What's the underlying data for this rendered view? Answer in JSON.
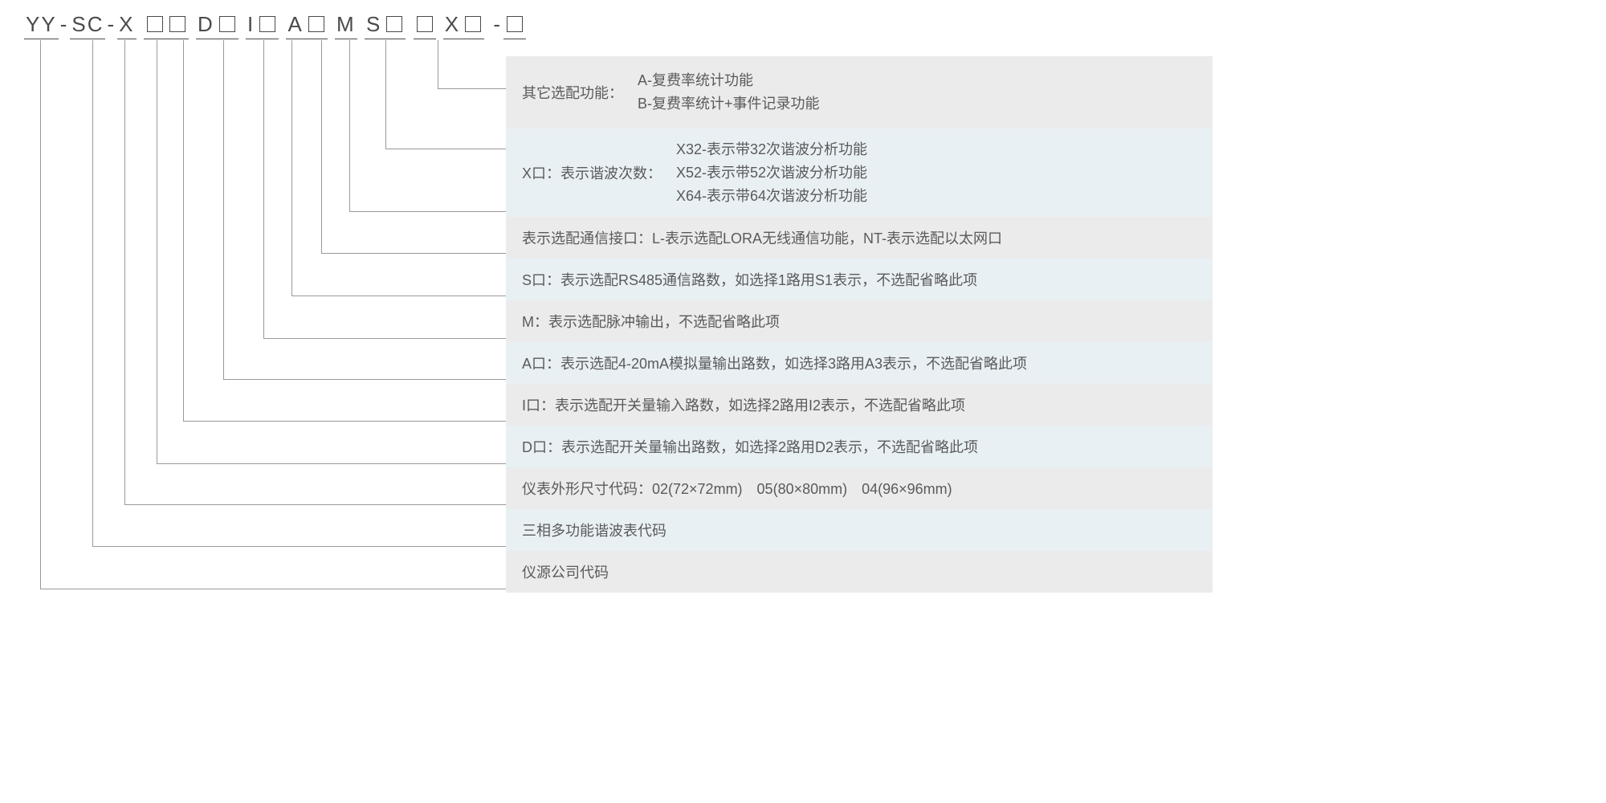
{
  "code": {
    "s1": "YY",
    "s2": "SC",
    "s3": "X",
    "s4": "D",
    "s5": "I",
    "s6": "A",
    "s7": "M",
    "s8": "S",
    "s9": "X"
  },
  "rows": {
    "r0_label": "其它选配功能：",
    "r0_a": "A-复费率统计功能",
    "r0_b": "B-复费率统计+事件记录功能",
    "r1_label": "X口：表示谐波次数：",
    "r1_a": "X32-表示带32次谐波分析功能",
    "r1_b": "X52-表示带52次谐波分析功能",
    "r1_c": "X64-表示带64次谐波分析功能",
    "r2": "表示选配通信接口：L-表示选配LORA无线通信功能，NT-表示选配以太网口",
    "r3": "S口：表示选配RS485通信路数，如选择1路用S1表示，不选配省略此项",
    "r4": "M：表示选配脉冲输出，不选配省略此项",
    "r5": "A口：表示选配4-20mA模拟量输出路数，如选择3路用A3表示，不选配省略此项",
    "r6": "I口：表示选配开关量输入路数，如选择2路用I2表示，不选配省略此项",
    "r7": "D口：表示选配开关量输出路数，如选择2路用D2表示，不选配省略此项",
    "r8": "仪表外形尺寸代码：02(72×72mm)　05(80×80mm)　04(96×96mm)",
    "r9": "三相多功能谐波表代码",
    "r10": "仪源公司代码"
  },
  "box_char": "口"
}
